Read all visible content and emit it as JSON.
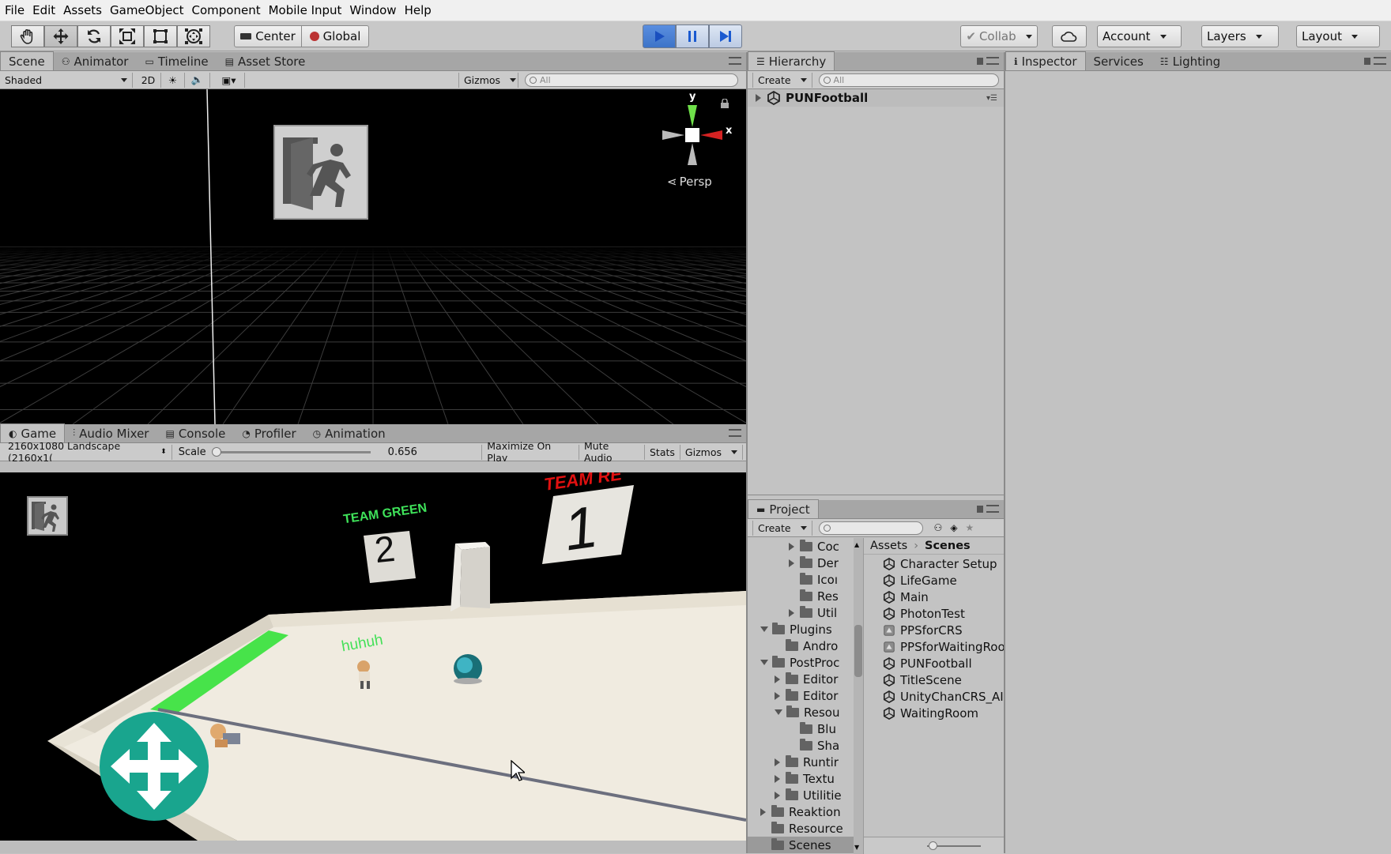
{
  "menu": [
    "File",
    "Edit",
    "Assets",
    "GameObject",
    "Component",
    "Mobile Input",
    "Window",
    "Help"
  ],
  "toolbar": {
    "tools": [
      "hand-tool-icon",
      "move-tool-icon",
      "rotate-tool-icon",
      "scale-tool-icon",
      "rect-tool-icon",
      "transform-tool-icon"
    ],
    "pivot": "Center",
    "space": "Global",
    "collab": "Collab",
    "account": "Account",
    "layers": "Layers",
    "layout": "Layout",
    "colors": {
      "play_active": "#3d7ad6"
    }
  },
  "scene": {
    "tabs": [
      "Scene",
      "Animator",
      "Timeline",
      "Asset Store"
    ],
    "shading": "Shaded",
    "mode_2d": "2D",
    "gizmos": "Gizmos",
    "search_placeholder": "All",
    "persp": "Persp",
    "axis_y": "y",
    "axis_x": "x"
  },
  "game": {
    "tabs": [
      "Game",
      "Audio Mixer",
      "Console",
      "Profiler",
      "Animation"
    ],
    "resolution": "2160x1080 Landscape (2160x1(",
    "scale_label": "Scale",
    "scale_value": "0.656",
    "maximize": "Maximize On Play",
    "mute": "Mute Audio",
    "stats": "Stats",
    "gizmos": "Gizmos",
    "team_green": "TEAM GREEN",
    "team_red": "TEAM RE",
    "score_green": "2",
    "score_red": "1",
    "player_name": "huhuh",
    "colors": {
      "green": "#3fe35a",
      "red": "#e01010",
      "dpad": "#19a58e"
    }
  },
  "hierarchy": {
    "tab": "Hierarchy",
    "create": "Create",
    "search_placeholder": "All",
    "root": "PUNFootball"
  },
  "project": {
    "tab": "Project",
    "create": "Create",
    "tree": [
      {
        "label": "Coc",
        "indent": 2,
        "arrow": "right"
      },
      {
        "label": "Der",
        "indent": 2,
        "arrow": "right"
      },
      {
        "label": "Icoı",
        "indent": 2,
        "arrow": "none"
      },
      {
        "label": "Res",
        "indent": 2,
        "arrow": "none"
      },
      {
        "label": "Util",
        "indent": 2,
        "arrow": "right"
      },
      {
        "label": "Plugins",
        "indent": 0,
        "arrow": "down"
      },
      {
        "label": "Andro",
        "indent": 1,
        "arrow": "none"
      },
      {
        "label": "PostProc",
        "indent": 0,
        "arrow": "down"
      },
      {
        "label": "Editor",
        "indent": 1,
        "arrow": "right"
      },
      {
        "label": "Editor",
        "indent": 1,
        "arrow": "right"
      },
      {
        "label": "Resou",
        "indent": 1,
        "arrow": "down"
      },
      {
        "label": "Blu",
        "indent": 2,
        "arrow": "none"
      },
      {
        "label": "Sha",
        "indent": 2,
        "arrow": "none"
      },
      {
        "label": "Runtir",
        "indent": 1,
        "arrow": "right"
      },
      {
        "label": "Textu",
        "indent": 1,
        "arrow": "right"
      },
      {
        "label": "Utilitie",
        "indent": 1,
        "arrow": "right"
      },
      {
        "label": "Reaktion",
        "indent": 0,
        "arrow": "right"
      },
      {
        "label": "Resource",
        "indent": 0,
        "arrow": "none"
      },
      {
        "label": "Scenes",
        "indent": 0,
        "arrow": "none"
      }
    ],
    "breadcrumb_root": "Assets",
    "breadcrumb_current": "Scenes",
    "files": [
      {
        "label": "Character Setup",
        "icon": "unity-scene-icon"
      },
      {
        "label": "LifeGame",
        "icon": "unity-scene-icon"
      },
      {
        "label": "Main",
        "icon": "unity-scene-icon"
      },
      {
        "label": "PhotonTest",
        "icon": "unity-scene-icon"
      },
      {
        "label": "PPSforCRS",
        "icon": "postprocess-profile-icon"
      },
      {
        "label": "PPSforWaitingRoo",
        "icon": "postprocess-profile-icon"
      },
      {
        "label": "PUNFootball",
        "icon": "unity-scene-icon"
      },
      {
        "label": "TitleScene",
        "icon": "unity-scene-icon"
      },
      {
        "label": "UnityChanCRS_AI",
        "icon": "unity-scene-icon"
      },
      {
        "label": "WaitingRoom",
        "icon": "unity-scene-icon"
      }
    ]
  },
  "inspector": {
    "tabs": [
      "Inspector",
      "Services",
      "Lighting"
    ]
  }
}
